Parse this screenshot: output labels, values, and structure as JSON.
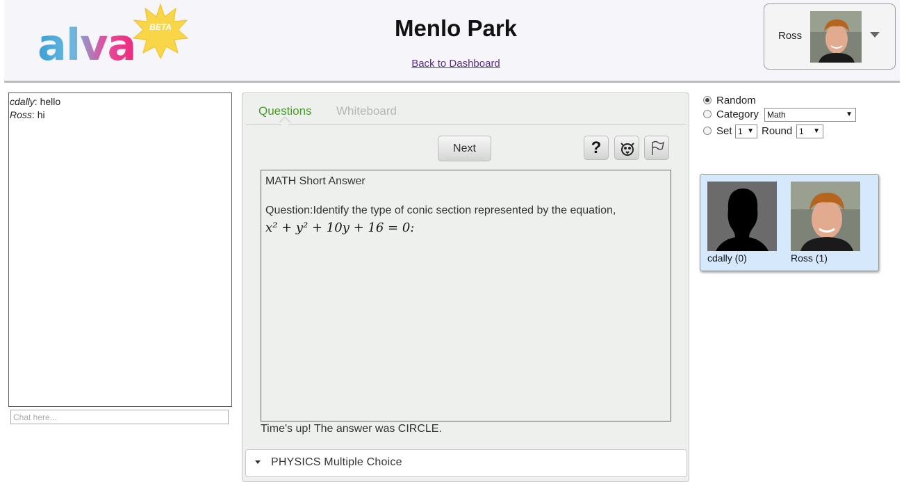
{
  "header": {
    "logo_text": "alva",
    "beta_label": "BETA",
    "room_title": "Menlo Park",
    "back_link": "Back to Dashboard",
    "user_name": "Ross"
  },
  "chat": {
    "messages": [
      {
        "user": "cdally",
        "text": "hello"
      },
      {
        "user": "Ross",
        "text": "hi"
      }
    ],
    "input_placeholder": "Chat here..."
  },
  "tabs": {
    "questions": "Questions",
    "whiteboard": "Whiteboard"
  },
  "toolbar": {
    "next_label": "Next",
    "help_icon": "?"
  },
  "question": {
    "header": "MATH Short Answer",
    "text": "Question:Identify the type of conic section represented by the equation,",
    "equation": "x² + y² + 10y + 16 = 0:",
    "answer_note": "Time's up! The answer was CIRCLE."
  },
  "next_section": {
    "label": "PHYSICS Multiple Choice"
  },
  "options": {
    "random_label": "Random",
    "category_label": "Category",
    "category_value": "Math",
    "set_label": "Set",
    "set_value": "1",
    "round_label": "Round",
    "round_value": "1",
    "selected": "Random"
  },
  "players": [
    {
      "name": "cdally (0)"
    },
    {
      "name": "Ross (1)"
    }
  ],
  "colors": {
    "accent_green": "#4a9b2a",
    "players_panel": "#d6e8fb",
    "logo_blue": "#3a9fd6",
    "logo_pink": "#ee2a7b",
    "beta_yellow": "#f7d23a"
  }
}
